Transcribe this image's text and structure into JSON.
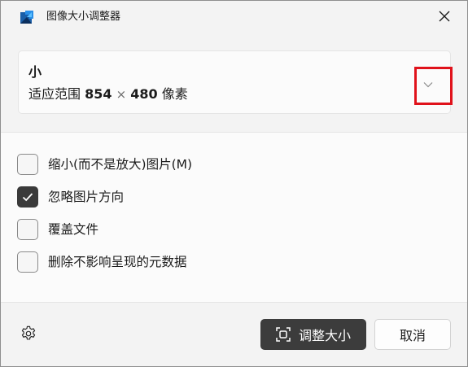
{
  "window": {
    "title": "图像大小调整器"
  },
  "size_selector": {
    "name": "小",
    "desc_prefix": "适应范围",
    "width": "854",
    "times": "×",
    "height": "480",
    "unit": "像素"
  },
  "options": [
    {
      "label": "缩小(而不是放大)图片(M)",
      "checked": false
    },
    {
      "label": "忽略图片方向",
      "checked": true
    },
    {
      "label": "覆盖文件",
      "checked": false
    },
    {
      "label": "删除不影响呈现的元数据",
      "checked": false
    }
  ],
  "footer": {
    "resize_label": "调整大小",
    "cancel_label": "取消"
  },
  "colors": {
    "accent_dark": "#3c3c3c",
    "highlight": "#e0121b"
  },
  "icons": {
    "app": "image-resizer-icon",
    "close": "close-icon",
    "dropdown": "chevron-down-icon",
    "settings": "gear-icon",
    "resize": "resize-icon",
    "check": "checkmark-icon"
  }
}
